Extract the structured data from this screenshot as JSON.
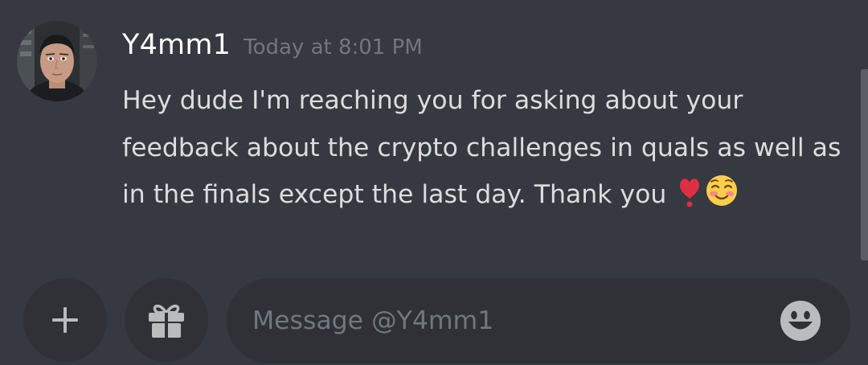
{
  "message": {
    "author": "Y4mm1",
    "timestamp": "Today at 8:01 PM",
    "text": "Hey dude I'm reaching you for asking about your feedback about the crypto challenges in quals as well as in the finals except the last day. Thank you",
    "emojis": [
      "heavy-heart-exclamation-emoji",
      "smiling-face-emoji"
    ]
  },
  "composer": {
    "placeholder": "Message @Y4mm1",
    "value": ""
  },
  "colors": {
    "background": "#36393f",
    "surface": "#2f3136",
    "author_text": "#ffffff",
    "body_text": "#dcddde",
    "muted_text": "#72767d",
    "heart": "#dd2e44",
    "icon": "#b9bbbe"
  }
}
